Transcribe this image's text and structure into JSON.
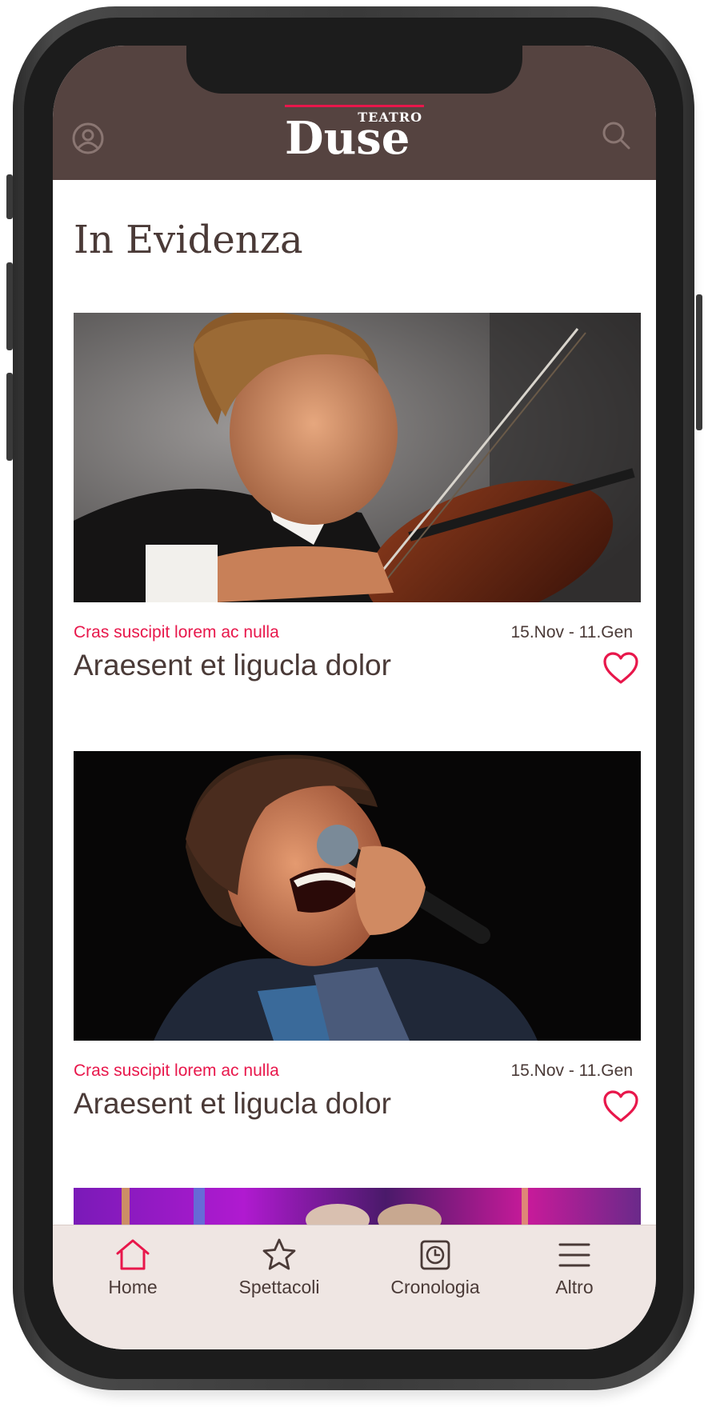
{
  "app": {
    "logo_small": "TEATRO",
    "logo_big": "Duse",
    "colors": {
      "header_bg": "#554340",
      "accent": "#e8174b",
      "text": "#4a3a37",
      "nav_bg": "#efe6e3"
    }
  },
  "header": {
    "left_icon": "user-profile-icon",
    "right_icon": "search-icon"
  },
  "main": {
    "title": "In Evidenza",
    "cards": [
      {
        "image": "violinist-photo",
        "subtitle": "Cras suscipit lorem ac nulla",
        "date": "15.Nov - 11.Gen",
        "title": "Araesent et ligucla dolor",
        "favorite_icon": "heart-icon"
      },
      {
        "image": "singer-photo",
        "subtitle": "Cras suscipit lorem ac nulla",
        "date": "15.Nov - 11.Gen",
        "title": "Araesent et ligucla dolor",
        "favorite_icon": "heart-icon"
      },
      {
        "image": "stage-photo"
      }
    ]
  },
  "bottom_nav": {
    "items": [
      {
        "label": "Home",
        "icon": "home-icon",
        "active": true
      },
      {
        "label": "Spettacoli",
        "icon": "star-icon",
        "active": false
      },
      {
        "label": "Cronologia",
        "icon": "clock-icon",
        "active": false
      },
      {
        "label": "Altro",
        "icon": "menu-icon",
        "active": false
      }
    ]
  }
}
